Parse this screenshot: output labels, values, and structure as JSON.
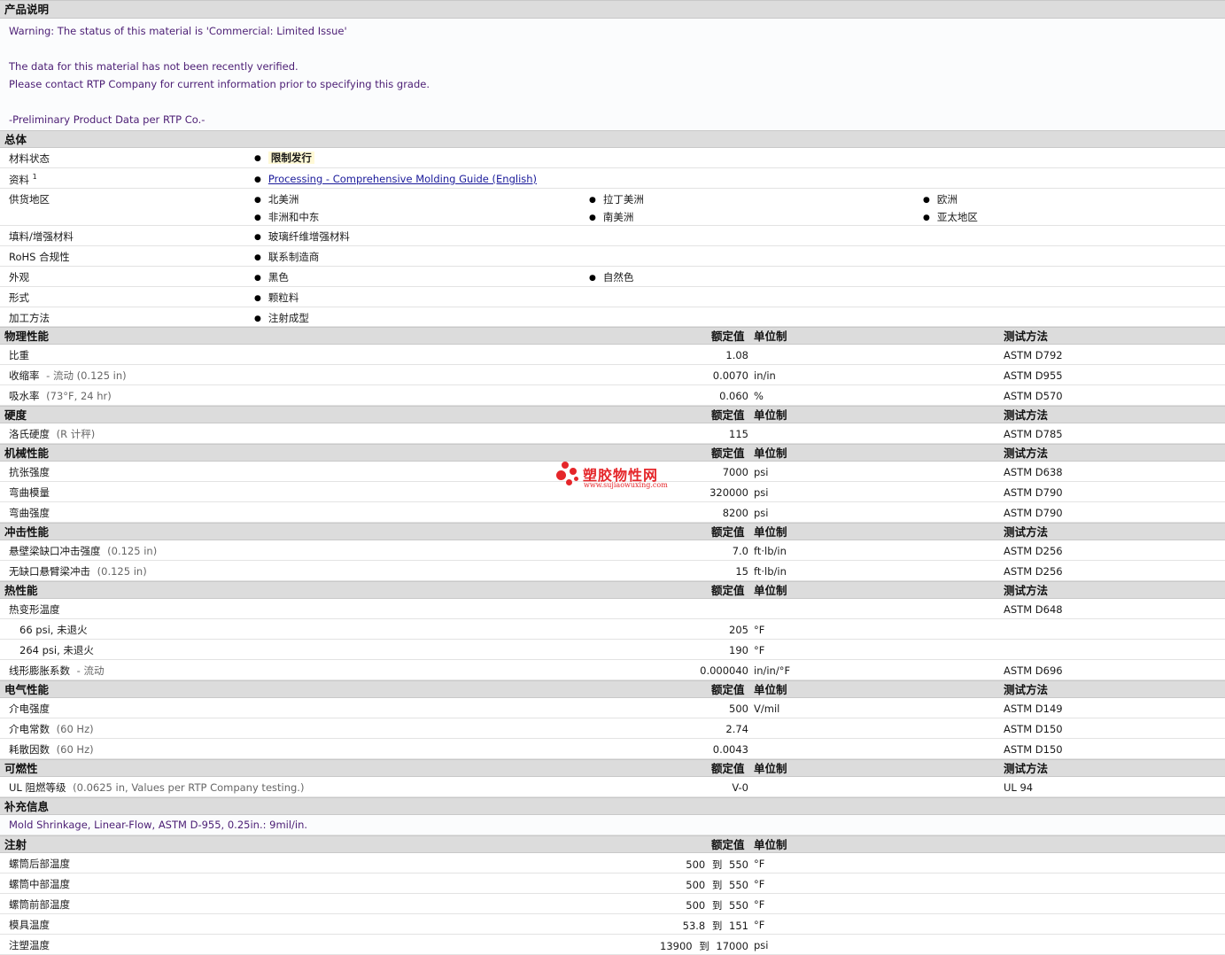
{
  "desc": {
    "title": "产品说明",
    "lines": [
      "Warning: The status of this material is 'Commercial: Limited Issue'",
      "",
      "The data for this material has not been recently verified.",
      "Please contact RTP Company for current information prior to specifying this grade.",
      "",
      "-Preliminary Product Data per RTP Co.-"
    ]
  },
  "general": {
    "title": "总体",
    "status_label": "材料状态",
    "status_value": "限制发行",
    "doc_label": "资料",
    "doc_sup": "1",
    "doc_link": "Processing - Comprehensive Molding Guide (English)",
    "region_label": "供货地区",
    "regions": [
      "北美洲",
      "拉丁美洲",
      "欧洲",
      "非洲和中东",
      "南美洲",
      "亚太地区"
    ],
    "filler_label": "填料/增强材料",
    "filler_value": "玻璃纤维增强材料",
    "rohs_label": "RoHS 合规性",
    "rohs_value": "联系制造商",
    "look_label": "外观",
    "look_values": [
      "黑色",
      "自然色"
    ],
    "form_label": "形式",
    "form_value": "颗粒料",
    "process_label": "加工方法",
    "process_value": "注射成型"
  },
  "col": {
    "value": "额定值",
    "unit": "单位制",
    "method": "测试方法"
  },
  "physical": {
    "title": "物理性能",
    "rows": [
      {
        "label": "比重",
        "cond": "",
        "value": "1.08",
        "unit": "",
        "method": "ASTM D792"
      },
      {
        "label": "收缩率",
        "cond": "- 流动  (0.125 in)",
        "value": "0.0070",
        "unit": "in/in",
        "method": "ASTM D955"
      },
      {
        "label": "吸水率",
        "cond": "(73°F, 24 hr)",
        "value": "0.060",
        "unit": "%",
        "method": "ASTM D570"
      }
    ]
  },
  "hardness": {
    "title": "硬度",
    "rows": [
      {
        "label": "洛氏硬度",
        "cond": "(R 计秤)",
        "value": "115",
        "unit": "",
        "method": "ASTM D785"
      }
    ]
  },
  "mechanical": {
    "title": "机械性能",
    "rows": [
      {
        "label": "抗张强度",
        "cond": "",
        "value": "7000",
        "unit": "psi",
        "method": "ASTM D638"
      },
      {
        "label": "弯曲模量",
        "cond": "",
        "value": "320000",
        "unit": "psi",
        "method": "ASTM D790"
      },
      {
        "label": "弯曲强度",
        "cond": "",
        "value": "8200",
        "unit": "psi",
        "method": "ASTM D790"
      }
    ]
  },
  "impact": {
    "title": "冲击性能",
    "rows": [
      {
        "label": "悬壁梁缺口冲击强度",
        "cond": "(0.125 in)",
        "value": "7.0",
        "unit": "ft·lb/in",
        "method": "ASTM D256"
      },
      {
        "label": "无缺口悬臂梁冲击",
        "cond": "(0.125 in)",
        "value": "15",
        "unit": "ft·lb/in",
        "method": "ASTM D256"
      }
    ]
  },
  "thermal": {
    "title": "热性能",
    "hdt_label": "热变形温度",
    "hdt_method": "ASTM D648",
    "hdt1_label": "66 psi, 未退火",
    "hdt1_value": "205",
    "hdt1_unit": "°F",
    "hdt2_label": "264 psi, 未退火",
    "hdt2_value": "190",
    "hdt2_unit": "°F",
    "clte_label": "线形膨胀系数",
    "clte_cond": "- 流动",
    "clte_value": "0.000040",
    "clte_unit": "in/in/°F",
    "clte_method": "ASTM D696"
  },
  "electrical": {
    "title": "电气性能",
    "rows": [
      {
        "label": "介电强度",
        "cond": "",
        "value": "500",
        "unit": "V/mil",
        "method": "ASTM D149"
      },
      {
        "label": "介电常数",
        "cond": "(60 Hz)",
        "value": "2.74",
        "unit": "",
        "method": "ASTM D150"
      },
      {
        "label": "耗散因数",
        "cond": "(60 Hz)",
        "value": "0.0043",
        "unit": "",
        "method": "ASTM D150"
      }
    ]
  },
  "flammability": {
    "title": "可燃性",
    "rows": [
      {
        "label": "UL 阻燃等级",
        "cond": "(0.0625 in, Values per RTP Company testing.)",
        "value": "V-0",
        "unit": "",
        "method": "UL 94"
      }
    ]
  },
  "supplement": {
    "title": "补充信息",
    "text": "Mold Shrinkage, Linear-Flow, ASTM D-955, 0.25in.: 9mil/in."
  },
  "injection": {
    "title": "注射",
    "to": "到",
    "rows": [
      {
        "label": "螺筒后部温度",
        "from": "500",
        "to_val": "550",
        "unit": "°F"
      },
      {
        "label": "螺筒中部温度",
        "from": "500",
        "to_val": "550",
        "unit": "°F"
      },
      {
        "label": "螺筒前部温度",
        "from": "500",
        "to_val": "550",
        "unit": "°F"
      },
      {
        "label": "模具温度",
        "from": "53.8",
        "to_val": "151",
        "unit": "°F"
      },
      {
        "label": "注塑温度",
        "from": "13900",
        "to_val": "17000",
        "unit": "psi"
      }
    ]
  },
  "watermark": {
    "name": "塑胶物性网",
    "url": "www.sujiaowuxing.com"
  }
}
